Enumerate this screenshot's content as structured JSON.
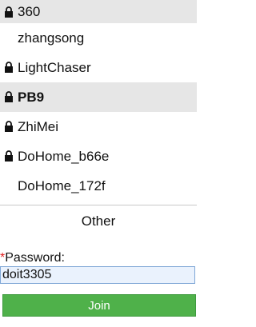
{
  "networks": [
    {
      "name": "360",
      "locked": true,
      "highlighted": true,
      "bold": false
    },
    {
      "name": "zhangsong",
      "locked": false,
      "highlighted": false,
      "bold": false
    },
    {
      "name": "LightChaser",
      "locked": true,
      "highlighted": false,
      "bold": false
    },
    {
      "name": "PB9",
      "locked": true,
      "highlighted": true,
      "bold": true
    },
    {
      "name": "ZhiMei",
      "locked": true,
      "highlighted": false,
      "bold": false
    },
    {
      "name": "DoHome_b66e",
      "locked": true,
      "highlighted": false,
      "bold": false
    },
    {
      "name": "DoHome_172f",
      "locked": false,
      "highlighted": false,
      "bold": false
    }
  ],
  "other_label": "Other",
  "password": {
    "required_mark": "*",
    "label": "Password:",
    "value": "doit3305"
  },
  "join_label": "Join",
  "colors": {
    "join_button": "#4fb14a",
    "required_mark": "#e02020",
    "highlight_row": "#e6e6e6",
    "input_background": "#eaf2fd"
  },
  "icons": {
    "lock": "lock-icon"
  }
}
